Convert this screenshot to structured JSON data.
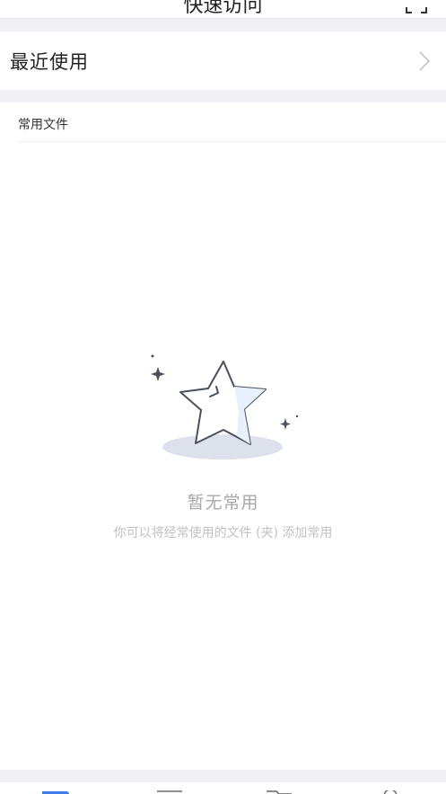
{
  "header": {
    "title": "快速访问"
  },
  "recent": {
    "label": "最近使用"
  },
  "section": {
    "label": "常用文件"
  },
  "empty": {
    "title": "暂无常用",
    "subtitle": "你可以将经常使用的文件 (夹) 添加常用"
  },
  "tabs": [
    {
      "icon": "quick-access-icon",
      "active": true
    },
    {
      "icon": "document-icon",
      "active": false
    },
    {
      "icon": "folder-icon",
      "active": false
    },
    {
      "icon": "profile-icon",
      "active": false
    }
  ],
  "colors": {
    "accent": "#3f7ce8",
    "background": "#f1f1f5",
    "muted": "#a8a8a8"
  }
}
